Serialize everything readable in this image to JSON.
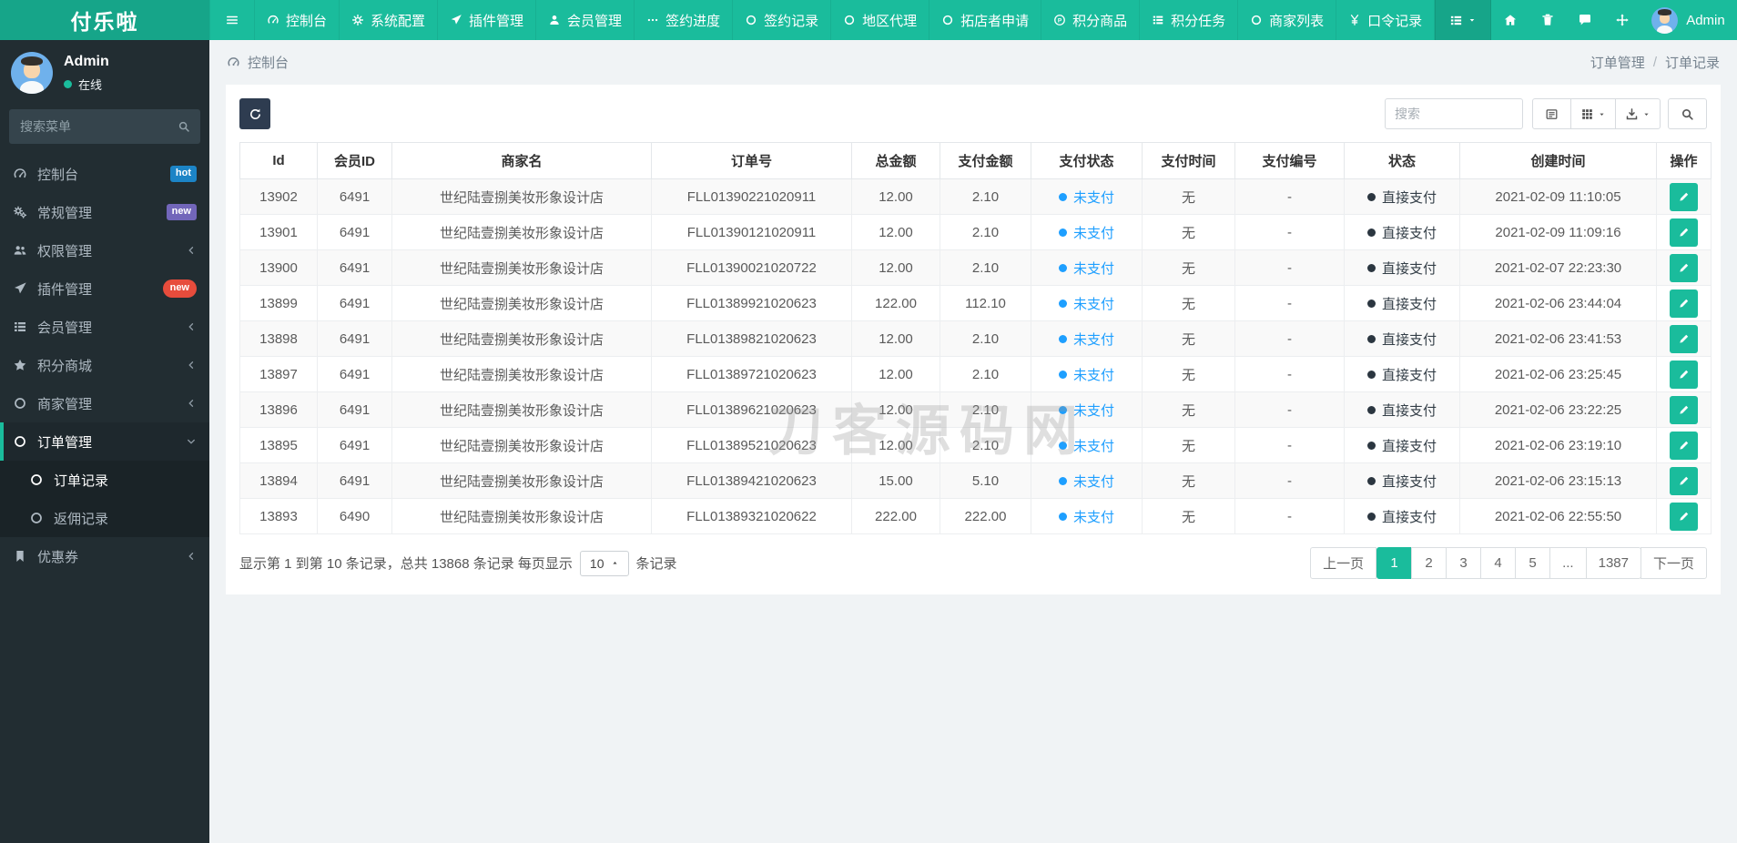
{
  "brand": {
    "logo": "付乐啦"
  },
  "topnav": {
    "items": [
      {
        "label": "控制台",
        "icon": "dashboard"
      },
      {
        "label": "系统配置",
        "icon": "gear"
      },
      {
        "label": "插件管理",
        "icon": "plane"
      },
      {
        "label": "会员管理",
        "icon": "user"
      },
      {
        "label": "签约进度",
        "icon": "ellipsis"
      },
      {
        "label": "签约记录",
        "icon": "circle"
      },
      {
        "label": "地区代理",
        "icon": "circle"
      },
      {
        "label": "拓店者申请",
        "icon": "circle"
      },
      {
        "label": "积分商品",
        "icon": "product"
      },
      {
        "label": "积分任务",
        "icon": "list"
      },
      {
        "label": "商家列表",
        "icon": "circle"
      },
      {
        "label": "口令记录",
        "icon": "yen"
      }
    ],
    "right_icons": [
      {
        "name": "home",
        "icon": "home"
      },
      {
        "name": "trash",
        "icon": "trash"
      },
      {
        "name": "message",
        "icon": "chat"
      },
      {
        "name": "expand",
        "icon": "expand"
      }
    ],
    "admin_label": "Admin"
  },
  "sidebar": {
    "user": {
      "name": "Admin",
      "status": "在线"
    },
    "search_placeholder": "搜索菜单",
    "badge_colors": {
      "info": "#1c84c6",
      "purple": "#7266ba",
      "danger": "#e74c3c"
    },
    "items": [
      {
        "label": "控制台",
        "icon": "dashboard",
        "badge": "hot",
        "badge_type": "info"
      },
      {
        "label": "常规管理",
        "icon": "cogs",
        "badge": "new",
        "badge_type": "purple"
      },
      {
        "label": "权限管理",
        "icon": "users",
        "chevron": "left"
      },
      {
        "label": "插件管理",
        "icon": "plane",
        "badge": "new",
        "badge_type": "danger",
        "badge_pill": true
      },
      {
        "label": "会员管理",
        "icon": "list",
        "chevron": "left"
      },
      {
        "label": "积分商城",
        "icon": "star",
        "chevron": "left"
      },
      {
        "label": "商家管理",
        "icon": "circle",
        "chevron": "left"
      },
      {
        "label": "订单管理",
        "icon": "circle",
        "chevron": "down",
        "active": true
      },
      {
        "label": "订单记录",
        "icon": "circle",
        "sub": true,
        "sub_active": true
      },
      {
        "label": "返佣记录",
        "icon": "circle",
        "sub": true
      },
      {
        "label": "优惠券",
        "icon": "bookmark",
        "chevron": "left"
      }
    ]
  },
  "breadcrumb": {
    "left": "控制台",
    "parent": "订单管理",
    "sep": "/",
    "current": "订单记录"
  },
  "toolbar": {
    "search_placeholder": "搜索"
  },
  "table": {
    "columns": [
      "Id",
      "会员ID",
      "商家名",
      "订单号",
      "总金额",
      "支付金额",
      "支付状态",
      "支付时间",
      "支付编号",
      "状态",
      "创建时间",
      "操作"
    ],
    "rows": [
      {
        "id": "13902",
        "member_id": "6491",
        "shop": "世纪陆壹捌美妆形象设计店",
        "order_no": "FLL01390221020911",
        "total": "12.00",
        "pay_amount": "2.10",
        "pay_status": "未支付",
        "pay_time": "无",
        "pay_no": "-",
        "status": "直接支付",
        "created": "2021-02-09 11:10:05"
      },
      {
        "id": "13901",
        "member_id": "6491",
        "shop": "世纪陆壹捌美妆形象设计店",
        "order_no": "FLL01390121020911",
        "total": "12.00",
        "pay_amount": "2.10",
        "pay_status": "未支付",
        "pay_time": "无",
        "pay_no": "-",
        "status": "直接支付",
        "created": "2021-02-09 11:09:16"
      },
      {
        "id": "13900",
        "member_id": "6491",
        "shop": "世纪陆壹捌美妆形象设计店",
        "order_no": "FLL01390021020722",
        "total": "12.00",
        "pay_amount": "2.10",
        "pay_status": "未支付",
        "pay_time": "无",
        "pay_no": "-",
        "status": "直接支付",
        "created": "2021-02-07 22:23:30"
      },
      {
        "id": "13899",
        "member_id": "6491",
        "shop": "世纪陆壹捌美妆形象设计店",
        "order_no": "FLL01389921020623",
        "total": "122.00",
        "pay_amount": "112.10",
        "pay_status": "未支付",
        "pay_time": "无",
        "pay_no": "-",
        "status": "直接支付",
        "created": "2021-02-06 23:44:04"
      },
      {
        "id": "13898",
        "member_id": "6491",
        "shop": "世纪陆壹捌美妆形象设计店",
        "order_no": "FLL01389821020623",
        "total": "12.00",
        "pay_amount": "2.10",
        "pay_status": "未支付",
        "pay_time": "无",
        "pay_no": "-",
        "status": "直接支付",
        "created": "2021-02-06 23:41:53"
      },
      {
        "id": "13897",
        "member_id": "6491",
        "shop": "世纪陆壹捌美妆形象设计店",
        "order_no": "FLL01389721020623",
        "total": "12.00",
        "pay_amount": "2.10",
        "pay_status": "未支付",
        "pay_time": "无",
        "pay_no": "-",
        "status": "直接支付",
        "created": "2021-02-06 23:25:45"
      },
      {
        "id": "13896",
        "member_id": "6491",
        "shop": "世纪陆壹捌美妆形象设计店",
        "order_no": "FLL01389621020623",
        "total": "12.00",
        "pay_amount": "2.10",
        "pay_status": "未支付",
        "pay_time": "无",
        "pay_no": "-",
        "status": "直接支付",
        "created": "2021-02-06 23:22:25"
      },
      {
        "id": "13895",
        "member_id": "6491",
        "shop": "世纪陆壹捌美妆形象设计店",
        "order_no": "FLL01389521020623",
        "total": "12.00",
        "pay_amount": "2.10",
        "pay_status": "未支付",
        "pay_time": "无",
        "pay_no": "-",
        "status": "直接支付",
        "created": "2021-02-06 23:19:10"
      },
      {
        "id": "13894",
        "member_id": "6491",
        "shop": "世纪陆壹捌美妆形象设计店",
        "order_no": "FLL01389421020623",
        "total": "15.00",
        "pay_amount": "5.10",
        "pay_status": "未支付",
        "pay_time": "无",
        "pay_no": "-",
        "status": "直接支付",
        "created": "2021-02-06 23:15:13"
      },
      {
        "id": "13893",
        "member_id": "6490",
        "shop": "世纪陆壹捌美妆形象设计店",
        "order_no": "FLL01389321020622",
        "total": "222.00",
        "pay_amount": "222.00",
        "pay_status": "未支付",
        "pay_time": "无",
        "pay_no": "-",
        "status": "直接支付",
        "created": "2021-02-06 22:55:50"
      }
    ]
  },
  "pagination": {
    "summary_prefix": "显示第 1 到第 10 条记录，总共 13868 条记录 每页显示",
    "page_size": "10",
    "summary_suffix": "条记录",
    "prev_label": "上一页",
    "next_label": "下一页",
    "pages": [
      "1",
      "2",
      "3",
      "4",
      "5",
      "...",
      "1387"
    ],
    "active": "1"
  },
  "watermark": {
    "text": "刀客源码网"
  }
}
